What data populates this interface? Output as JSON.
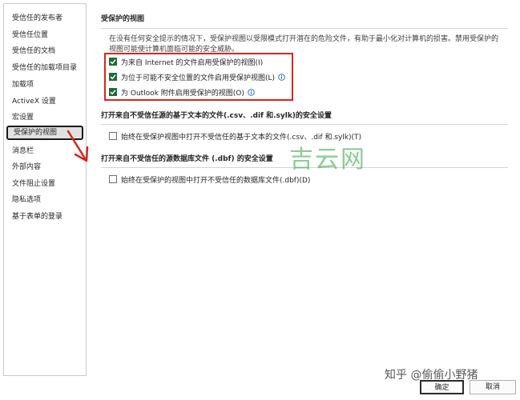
{
  "sidebar": {
    "items": [
      {
        "label": "受信任的发布者"
      },
      {
        "label": "受信任位置"
      },
      {
        "label": "受信任的文档"
      },
      {
        "label": "受信任的加载项目录"
      },
      {
        "label": "加载项"
      },
      {
        "label": "ActiveX 设置"
      },
      {
        "label": "宏设置"
      },
      {
        "label": "受保护的视图",
        "selected": true
      },
      {
        "label": "消息栏"
      },
      {
        "label": "外部内容"
      },
      {
        "label": "文件阻止设置"
      },
      {
        "label": "隐私选项"
      },
      {
        "label": "基于表单的登录"
      }
    ]
  },
  "main": {
    "section1": {
      "title": "受保护的视图",
      "description_lines": [
        "在没有任何安全提示的情况下，受保护视图以受限模式打开潜在的危险文件，有助于最小化对计算机的损害。禁用受保护的",
        "视图可能使计算机面临可能的安全威胁。"
      ],
      "options": [
        {
          "label": "为来自 Internet 的文件启用受保护的视图(I)",
          "checked": true
        },
        {
          "label": "为位于可能不安全位置的文件启用受保护视图(L)",
          "checked": true
        },
        {
          "label": "为 Outlook 附件启用受保护的视图(O)",
          "checked": true
        }
      ]
    },
    "section2": {
      "title": "打开来自不受信任源的基于文本的文件(.csv、.dif 和.sylk)的安全设置",
      "option": {
        "label": "始终在受保护视图中打开不受信任的基于文本的文件(.csv、.dif 和.sylk)(T)",
        "checked": false
      }
    },
    "section3": {
      "title": "打开来自不受信任的源数据库文件 (.dbf) 的安全设置",
      "option": {
        "label": "始终在受保护的视图中打开不受信任的数据库文件(.dbf)(D)",
        "checked": false
      }
    }
  },
  "watermarks": {
    "brand": "吉云网",
    "credit": "知乎 @偷偷小野猪"
  },
  "buttons": {
    "ok": "确定",
    "cancel": "取消"
  },
  "colors": {
    "checkbox_checked": "#1e6b34",
    "highlight_box": "#d9261c",
    "arrow": "#d9261c",
    "info_icon": "#1a66c2",
    "watermark_brand": "#3dab4f"
  },
  "icons": {
    "checked": "check-icon",
    "info": "info-icon",
    "annotation": "red-arrow"
  }
}
